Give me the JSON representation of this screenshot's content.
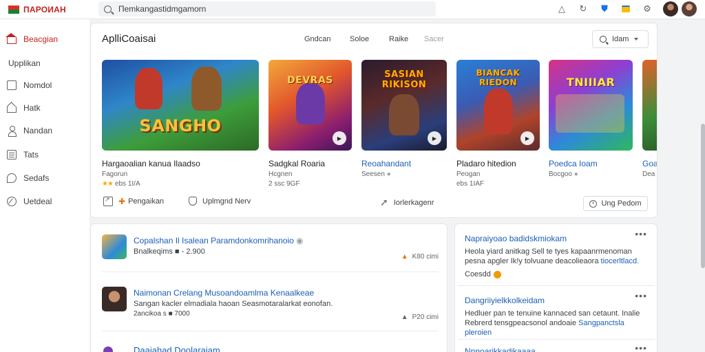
{
  "app": {
    "logo_text": "ПАРОИАН"
  },
  "search": {
    "value": "Пemkangastidmgamorn"
  },
  "sidebar": {
    "items": [
      {
        "label": "Beacgian",
        "icon": "home-icon"
      },
      {
        "label": "Upplikan",
        "icon": ""
      },
      {
        "label": "Nomdol",
        "icon": "square-icon"
      },
      {
        "label": "Hatk",
        "icon": "house-icon"
      },
      {
        "label": "Nandan",
        "icon": "person-icon"
      },
      {
        "label": "Tats",
        "icon": "list-icon"
      },
      {
        "label": "Sedafs",
        "icon": "chat-icon"
      },
      {
        "label": "Uetdeal",
        "icon": "pencil-icon"
      }
    ]
  },
  "main": {
    "title": "AplliCoaisai",
    "filters": [
      "Gndcan",
      "Soloe",
      "Raike",
      "Sacer"
    ],
    "filter_button": "Idam",
    "games": [
      {
        "art": "SANGHO",
        "title": "Hargaoalian kanua Ilaadso",
        "sub": "Fagorun",
        "rating": "ebs 1I/A"
      },
      {
        "art": "DEVRAS",
        "title": "Sadgkal Roaria",
        "sub": "Hcgnen",
        "rating": "2 ssc 9GF"
      },
      {
        "art": "SASIAN RIKISON",
        "title": "Reoahandant",
        "sub": "Seesen",
        "rating": ""
      },
      {
        "art": "BIANCAK RIEDON",
        "title": "Pladaro hitedion",
        "sub": "Peogan",
        "rating": "ebs 1IAF"
      },
      {
        "art": "TNIIIAR",
        "title": "Poedca Ioam",
        "sub": "Bocgoo",
        "rating": ""
      },
      {
        "art": "",
        "title": "Goa",
        "sub": "Dea",
        "rating": ""
      }
    ],
    "actions": {
      "first": "Pengaikan",
      "second": "Uplmgnd Nerv",
      "third": "Iorlerkagenr",
      "button": "Ung Pedom"
    }
  },
  "list": [
    {
      "title": "Copalshan Il Isalean Paramdonkomrihanoio",
      "desc": "Bnalkeqims ■ - 2.900",
      "meta": "",
      "stats": "K80 cimi"
    },
    {
      "title": "Naimonan Crelang Musoandoamlma Kenaalkeae",
      "desc": "Sangan kacler elmadiala haoan Seasmotaralarkat eonofan.",
      "meta": "2ancikoa s ■ 7000",
      "stats": "P20 cimi"
    },
    {
      "title": "Daaiahad Doolaraiam",
      "desc": "",
      "meta": "",
      "stats": ""
    }
  ],
  "news": [
    {
      "title": "Napraiyoao badidskmiokam",
      "body": "Heola yiard anitkag Sell te tyes kapaanrmenoman",
      "body2": "pesna apgler Ik!y tolvuane deacolieaora",
      "highlight": "tiocerltlacd.",
      "source": "Coesdd"
    },
    {
      "title": "Dangriiyielkkolkeidam",
      "body": "Hedluer pan te tenuine kannaced san cetaunt. Inalie",
      "body2": "Rebrerd tensgpeacsonol andoaie",
      "highlight": "Sangpanctsla pleroien",
      "source": ""
    },
    {
      "title": "Nnnoarikkadikaaaa",
      "body": "",
      "body2": "",
      "highlight": "",
      "source": ""
    }
  ]
}
